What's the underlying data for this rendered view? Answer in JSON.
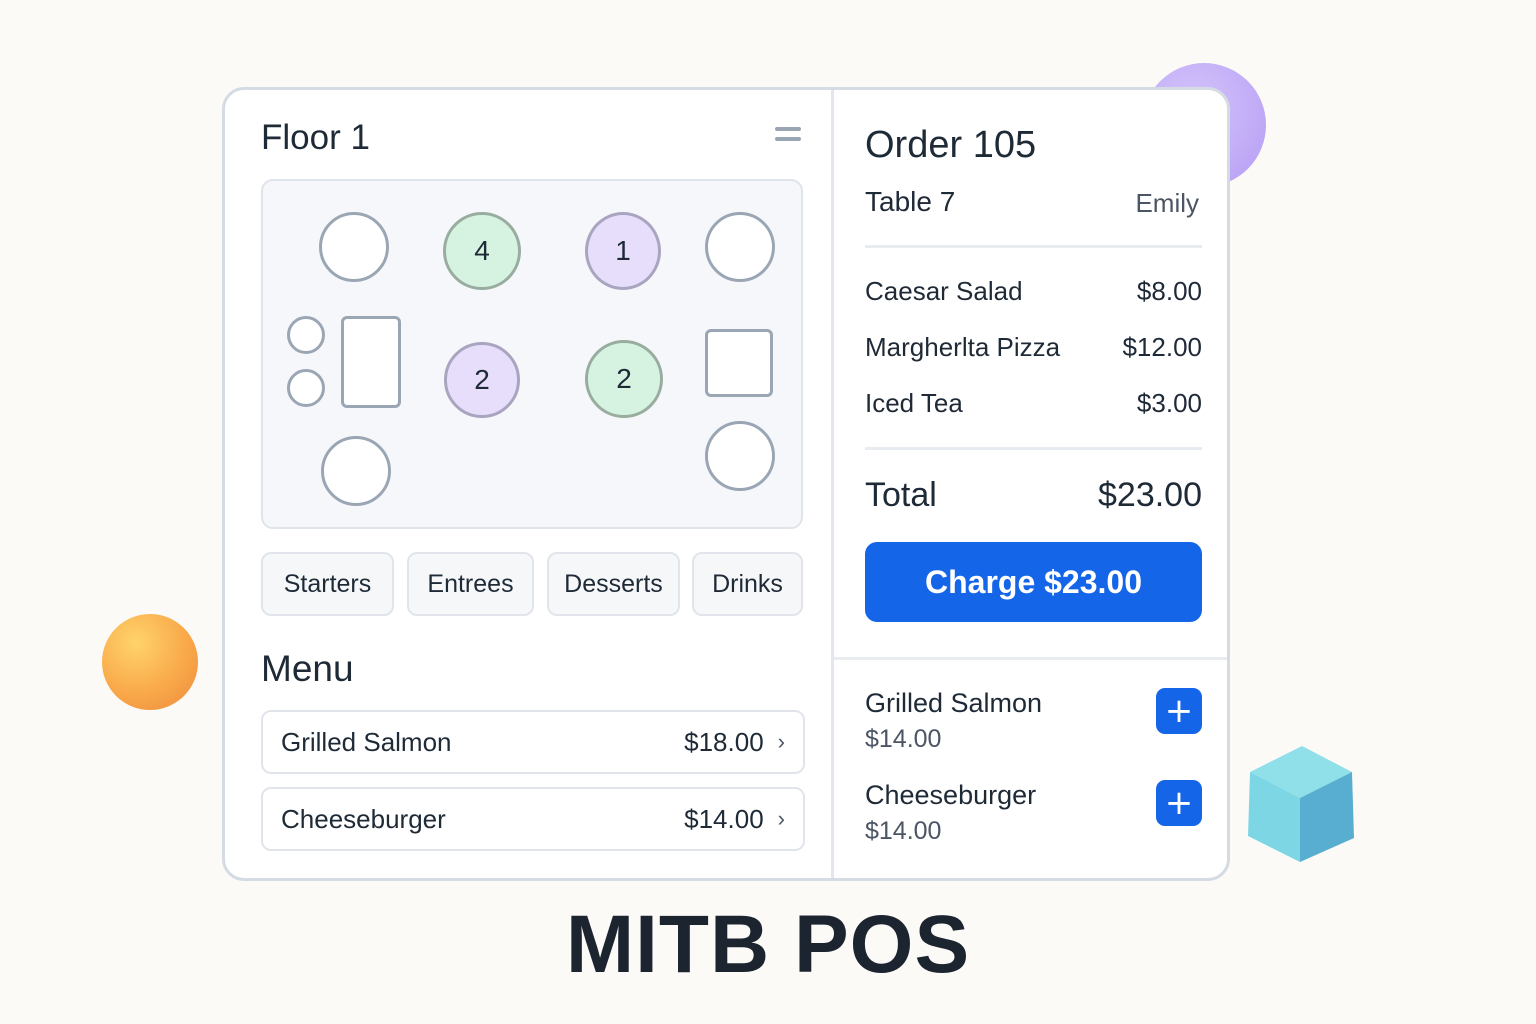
{
  "floor": {
    "title": "Floor 1",
    "tables": [
      {
        "id": "t-a",
        "label": "",
        "status": "empty"
      },
      {
        "id": "t-b",
        "label": "4",
        "status": "green"
      },
      {
        "id": "t-c",
        "label": "1",
        "status": "purple"
      },
      {
        "id": "t-d",
        "label": "",
        "status": "empty"
      },
      {
        "id": "t-e",
        "label": "",
        "status": "empty"
      },
      {
        "id": "t-f",
        "label": "2",
        "status": "purple"
      },
      {
        "id": "t-g",
        "label": "2",
        "status": "green"
      },
      {
        "id": "t-h",
        "label": "",
        "status": "empty"
      },
      {
        "id": "t-i",
        "label": "",
        "status": "empty"
      },
      {
        "id": "t-j",
        "label": "",
        "status": "empty"
      }
    ]
  },
  "categories": [
    "Starters",
    "Entrees",
    "Desserts",
    "Drinks"
  ],
  "menu": {
    "title": "Menu",
    "items": [
      {
        "name": "Grilled Salmon",
        "price": "$18.00"
      },
      {
        "name": "Cheeseburger",
        "price": "$14.00"
      }
    ]
  },
  "order": {
    "title": "Order 105",
    "table": "Table 7",
    "server": "Emily",
    "items": [
      {
        "name": "Caesar Salad",
        "price": "$8.00"
      },
      {
        "name": "Margherlta Pizza",
        "price": "$12.00"
      },
      {
        "name": "Iced Tea",
        "price": "$3.00"
      }
    ],
    "total_label": "Total",
    "total": "$23.00",
    "charge_label": "Charge $23.00"
  },
  "quick_add": [
    {
      "name": "Grilled Salmon",
      "price": "$14.00"
    },
    {
      "name": "Cheeseburger",
      "price": "$14.00"
    }
  ],
  "brand": "MITB POS",
  "colors": {
    "accent": "#1565e8",
    "table_green": "#d6f2e1",
    "table_purple": "#e7defb"
  }
}
